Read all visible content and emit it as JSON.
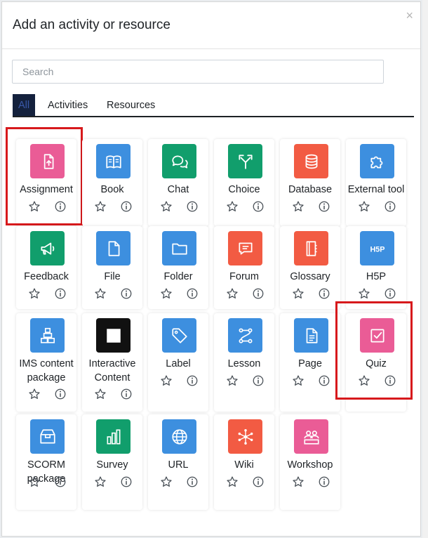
{
  "modal": {
    "title": "Add an activity or resource",
    "close": "×"
  },
  "search": {
    "placeholder": "Search"
  },
  "tabs": [
    {
      "label": "All",
      "active": true
    },
    {
      "label": "Activities",
      "active": false
    },
    {
      "label": "Resources",
      "active": false
    }
  ],
  "colors": {
    "pink": "#ea5c96",
    "blue": "#3d8fdf",
    "green": "#119e6c",
    "orange": "#f25b43",
    "black": "#111111",
    "highlight": "#d7191c"
  },
  "items": [
    {
      "name": "Assignment",
      "icon": "assignment-icon",
      "color": "pink",
      "highlighted": true
    },
    {
      "name": "Book",
      "icon": "book-icon",
      "color": "blue"
    },
    {
      "name": "Chat",
      "icon": "chat-icon",
      "color": "green"
    },
    {
      "name": "Choice",
      "icon": "choice-icon",
      "color": "green"
    },
    {
      "name": "Database",
      "icon": "database-icon",
      "color": "orange"
    },
    {
      "name": "External tool",
      "icon": "puzzle-icon",
      "color": "blue"
    },
    {
      "name": "Feedback",
      "icon": "megaphone-icon",
      "color": "green"
    },
    {
      "name": "File",
      "icon": "file-icon",
      "color": "blue"
    },
    {
      "name": "Folder",
      "icon": "folder-icon",
      "color": "blue"
    },
    {
      "name": "Forum",
      "icon": "forum-icon",
      "color": "orange"
    },
    {
      "name": "Glossary",
      "icon": "glossary-icon",
      "color": "orange"
    },
    {
      "name": "H5P",
      "icon": "h5p-icon",
      "color": "blue"
    },
    {
      "name": "IMS content package",
      "icon": "package-icon",
      "color": "blue"
    },
    {
      "name": "Interactive Content",
      "icon": "interactive-content-icon",
      "color": "black"
    },
    {
      "name": "Label",
      "icon": "tag-icon",
      "color": "blue"
    },
    {
      "name": "Lesson",
      "icon": "lesson-icon",
      "color": "blue"
    },
    {
      "name": "Page",
      "icon": "page-icon",
      "color": "blue"
    },
    {
      "name": "Quiz",
      "icon": "quiz-icon",
      "color": "pink",
      "highlighted": true
    },
    {
      "name": "SCORM package",
      "icon": "scorm-icon",
      "color": "blue"
    },
    {
      "name": "Survey",
      "icon": "bar-chart-icon",
      "color": "green"
    },
    {
      "name": "URL",
      "icon": "globe-icon",
      "color": "blue"
    },
    {
      "name": "Wiki",
      "icon": "wiki-icon",
      "color": "orange"
    },
    {
      "name": "Workshop",
      "icon": "workshop-icon",
      "color": "pink"
    }
  ]
}
